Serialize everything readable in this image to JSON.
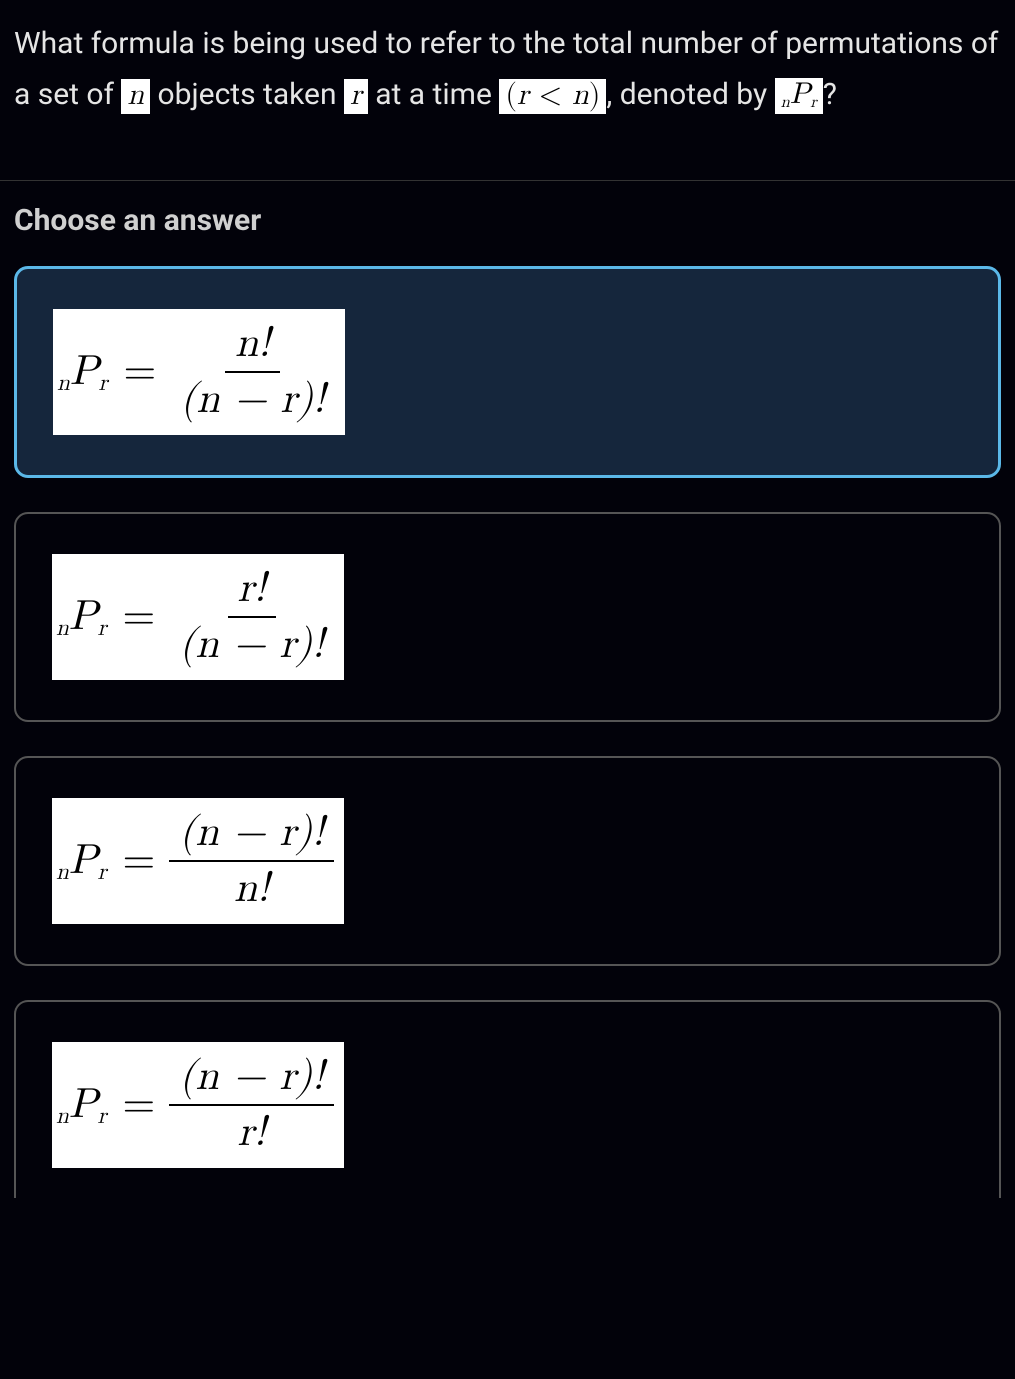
{
  "question": {
    "t1": "What formula is being used to refer to the total number of permutations of a set of ",
    "chip_n": "n",
    "t2": " objects taken ",
    "chip_r": "r",
    "t3": " at a time ",
    "chip_cond_open": "(",
    "chip_cond_var1": "r",
    "chip_cond_lt": " < ",
    "chip_cond_var2": "n",
    "chip_cond_close": ")",
    "t4": ", denoted by ",
    "chip_npr_pre": "n",
    "chip_npr_P": "P",
    "chip_npr_post": "r",
    "t5": "?"
  },
  "choose_label": "Choose an answer",
  "lhs": {
    "pre": "n",
    "P": "P",
    "post": "r",
    "eq": "="
  },
  "answers": [
    {
      "selected": true,
      "num": "n!",
      "den": "(n − r)!"
    },
    {
      "selected": false,
      "num": "r!",
      "den": "(n − r)!"
    },
    {
      "selected": false,
      "num": "(n − r)!",
      "den": "n!"
    },
    {
      "selected": false,
      "num": "(n − r)!",
      "den": "r!"
    }
  ]
}
